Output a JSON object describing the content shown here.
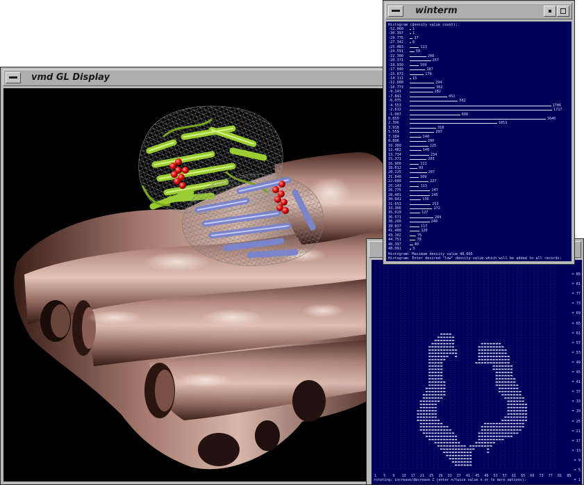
{
  "gl_window": {
    "title": "vmd GL Display"
  },
  "winterm": {
    "title": "winterm",
    "header_lines": [
      "Histogram (density value count):"
    ],
    "histogram": [
      {
        "v": "-52.060",
        "c": "1"
      },
      {
        "v": "-30.397",
        "c": "1"
      },
      {
        "v": "-29.775",
        "c": "37"
      },
      {
        "v": "-27.342",
        "c": "6"
      },
      {
        "v": "-25.483",
        "c": "113"
      },
      {
        "v": "-24.591",
        "c": "58"
      },
      {
        "v": "-22.300",
        "c": "200"
      },
      {
        "v": "-20.371",
        "c": "257"
      },
      {
        "v": "-18.930",
        "c": "109"
      },
      {
        "v": "-17.046",
        "c": "187"
      },
      {
        "v": "-15.873",
        "c": "170"
      },
      {
        "v": "-14.111",
        "c": "15"
      },
      {
        "v": "-12.080",
        "c": "294"
      },
      {
        "v": "-10.773",
        "c": "302"
      },
      {
        "v": "-9.143",
        "c": "282"
      },
      {
        "v": "-7.841",
        "c": "452"
      },
      {
        "v": "-6.075",
        "c": "582"
      },
      {
        "v": "-4.553",
        "c": "1706"
      },
      {
        "v": "-2.612",
        "c": "1717"
      },
      {
        "v": "-1.007",
        "c": "608"
      },
      {
        "v": "0.655",
        "c": "1640"
      },
      {
        "v": "2.396",
        "c": "1053"
      },
      {
        "v": "3.918",
        "c": "318"
      },
      {
        "v": "5.559",
        "c": "297"
      },
      {
        "v": "7.184",
        "c": "140"
      },
      {
        "v": "8.896",
        "c": "200"
      },
      {
        "v": "10.380",
        "c": "225"
      },
      {
        "v": "12.482",
        "c": "140"
      },
      {
        "v": "13.734",
        "c": "234"
      },
      {
        "v": "15.371",
        "c": "203"
      },
      {
        "v": "16.900",
        "c": "111"
      },
      {
        "v": "18.612",
        "c": "93"
      },
      {
        "v": "20.225",
        "c": "207"
      },
      {
        "v": "21.840",
        "c": "109"
      },
      {
        "v": "22.680",
        "c": "227"
      },
      {
        "v": "25.143",
        "c": "113"
      },
      {
        "v": "26.775",
        "c": "247"
      },
      {
        "v": "28.401",
        "c": "245"
      },
      {
        "v": "30.041",
        "c": "136"
      },
      {
        "v": "31.653",
        "c": "253"
      },
      {
        "v": "33.306",
        "c": "272"
      },
      {
        "v": "35.010",
        "c": "127"
      },
      {
        "v": "36.571",
        "c": "284"
      },
      {
        "v": "38.200",
        "c": "240"
      },
      {
        "v": "39.837",
        "c": "117"
      },
      {
        "v": "41.480",
        "c": "120"
      },
      {
        "v": "43.102",
        "c": "75"
      },
      {
        "v": "44.751",
        "c": "70"
      },
      {
        "v": "46.397",
        "c": "40"
      },
      {
        "v": "48.091",
        "c": "3"
      }
    ],
    "footer_lines": [
      "Histogram: Maximum density value 48.095",
      "Histogram: Enter desired \"low\" density value which will be added to all records:"
    ]
  },
  "slice_window": {
    "y_ticks": [
      "= 85",
      "= 81",
      "= 77",
      "= 73",
      "= 69",
      "= 65",
      "= 61",
      "= 57",
      "= 53",
      "= 49",
      "= 45",
      "= 41",
      "= 37",
      "= 33",
      "= 29",
      "= 25",
      "= 21",
      "= 17",
      "= 13",
      "= 9",
      "= 5",
      "= 1"
    ],
    "x_ticks": [
      "1",
      "5",
      "9",
      "13",
      "17",
      "21",
      "25",
      "29",
      "33",
      "37",
      "41",
      "45",
      "49",
      "53",
      "57",
      "61",
      "65",
      "69",
      "73",
      "77",
      "81",
      "85"
    ],
    "footer": "rotating: increase/decrease Z (enter n/twice value n or to more options):"
  }
}
